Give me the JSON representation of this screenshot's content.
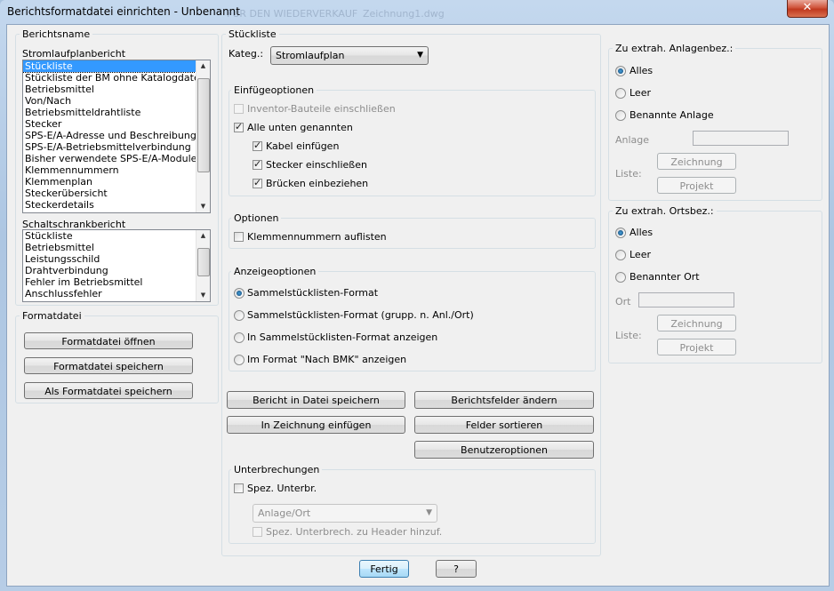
{
  "window": {
    "title": "Berichtsformatdatei einrichten - Unbenannt",
    "bg_text_1": "FUR DEN WIEDERVERKAUF",
    "bg_text_2": "Zeichnung1.dwg",
    "close_glyph": "✕"
  },
  "left": {
    "berichtsname_label": "Berichtsname",
    "stromlauf_label": "Stromlaufplanbericht",
    "stromlauf_items": [
      "Stückliste",
      "Stückliste der BM ohne Katalogdaten",
      "Betriebsmittel",
      "Von/Nach",
      "Betriebsmitteldrahtliste",
      "Stecker",
      "SPS-E/A-Adresse und Beschreibungen",
      "SPS-E/A-Betriebsmittelverbindung",
      "Bisher verwendete SPS-E/A-Module",
      "Klemmennummern",
      "Klemmenplan",
      "Steckerübersicht",
      "Steckerdetails"
    ],
    "schalt_label": "Schaltschrankbericht",
    "schalt_items": [
      "Stückliste",
      "Betriebsmittel",
      "Leistungsschild",
      "Drahtverbindung",
      "Fehler im Betriebsmittel",
      "Anschlussfehler"
    ],
    "formatdatei_label": "Formatdatei",
    "btn_open": "Formatdatei öffnen",
    "btn_save": "Formatdatei speichern",
    "btn_save_as": "Als Formatdatei speichern"
  },
  "mid": {
    "group_label": "Stückliste",
    "kateg_label": "Kateg.:",
    "kateg_value": "Stromlaufplan",
    "einfuege_label": "Einfügeoptionen",
    "inventor": "Inventor-Bauteile einschließen",
    "alle_unten": "Alle unten genannten",
    "kabel": "Kabel einfügen",
    "stecker": "Stecker einschließen",
    "bruecken": "Brücken einbeziehen",
    "optionen_label": "Optionen",
    "klemmen": "Klemmennummern auflisten",
    "anzeige_label": "Anzeigeoptionen",
    "anz1": "Sammelstücklisten-Format",
    "anz2": "Sammelstücklisten-Format (grupp. n. Anl./Ort)",
    "anz3": "In Sammelstücklisten-Format anzeigen",
    "anz4": "Im Format \"Nach BMK\" anzeigen",
    "btn_bericht": "Bericht in Datei speichern",
    "btn_felder": "Berichtsfelder ändern",
    "btn_zeichnung": "In Zeichnung einfügen",
    "btn_sortieren": "Felder sortieren",
    "btn_benutzer": "Benutzeroptionen",
    "unterbr_label": "Unterbrechungen",
    "spez": "Spez. Unterbr.",
    "unterbr_combo": "Anlage/Ort",
    "spez_header": "Spez. Unterbrech. zu Header hinzuf."
  },
  "right": {
    "anl_label": "Zu extrah. Anlagenbez.:",
    "anl_alles": "Alles",
    "anl_leer": "Leer",
    "anl_benannt": "Benannte Anlage",
    "anl_field": "Anlage",
    "anl_liste": "Liste:",
    "anl_zeichnung": "Zeichnung",
    "anl_projekt": "Projekt",
    "ort_label": "Zu extrah. Ortsbez.:",
    "ort_alles": "Alles",
    "ort_leer": "Leer",
    "ort_benannt": "Benannter Ort",
    "ort_field": "Ort",
    "ort_liste": "Liste:",
    "ort_zeichnung": "Zeichnung",
    "ort_projekt": "Projekt"
  },
  "footer": {
    "fertig": "Fertig",
    "help": "?"
  }
}
